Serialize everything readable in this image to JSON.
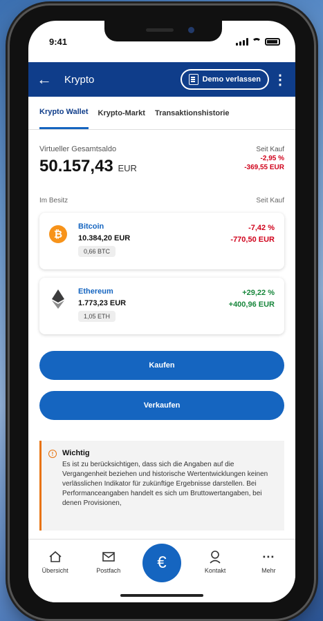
{
  "status_bar": {
    "time": "9:41"
  },
  "app_bar": {
    "title": "Krypto",
    "demo_button": "Demo verlassen"
  },
  "tabs": [
    {
      "label": "Krypto Wallet",
      "active": true
    },
    {
      "label": "Krypto-Markt",
      "active": false
    },
    {
      "label": "Transaktionshistorie",
      "active": false
    }
  ],
  "balance": {
    "label": "Virtueller Gesamtsaldo",
    "value": "50.157,43",
    "currency": "EUR",
    "since_label": "Seit Kauf",
    "change_pct": "-2,95 %",
    "change_eur": "-369,55 EUR"
  },
  "holdings": {
    "label": "Im Besitz",
    "since_label": "Seit Kauf",
    "items": [
      {
        "name": "Bitcoin",
        "value_eur": "10.384,20 EUR",
        "amount": "0,66 BTC",
        "change_pct": "-7,42 %",
        "change_eur": "-770,50 EUR",
        "trend": "negative",
        "icon": "bitcoin-icon",
        "color": "#f7931a"
      },
      {
        "name": "Ethereum",
        "value_eur": "1.773,23 EUR",
        "amount": "1,05 ETH",
        "change_pct": "+29,22 %",
        "change_eur": "+400,96 EUR",
        "trend": "positive",
        "icon": "ethereum-icon",
        "color": "#3c3c3d"
      }
    ]
  },
  "actions": {
    "buy": "Kaufen",
    "sell": "Verkaufen"
  },
  "notice": {
    "title": "Wichtig",
    "text": "Es ist zu berücksichtigen, dass sich die Angaben auf die Vergangenheit beziehen und historische Wertentwicklungen keinen verlässlichen Indikator für zukünftige Ergebnisse darstellen. Bei Performanceangaben handelt es sich um Bruttowertangaben, bei denen Provisionen,"
  },
  "bottom_nav": {
    "overview": "Übersicht",
    "mailbox": "Postfach",
    "center": "€",
    "contact": "Kontakt",
    "more": "Mehr"
  },
  "colors": {
    "brand": "#0f3d8a",
    "accent": "#1565c0",
    "negative": "#d0021b",
    "positive": "#17863b",
    "warning": "#e8720c"
  }
}
